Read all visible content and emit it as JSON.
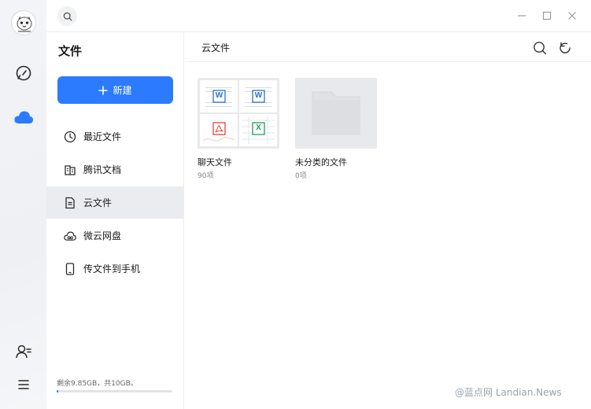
{
  "sidebar": {
    "title": "文件",
    "new_button_label": "新建",
    "items": [
      {
        "label": "最近文件",
        "icon": "clock-icon",
        "active": false
      },
      {
        "label": "腾讯文档",
        "icon": "tencent-docs-icon",
        "active": false
      },
      {
        "label": "云文件",
        "icon": "document-icon",
        "active": true
      },
      {
        "label": "微云网盘",
        "icon": "cloud-drive-icon",
        "active": false
      },
      {
        "label": "传文件到手机",
        "icon": "phone-icon",
        "active": false
      }
    ],
    "storage_text": "剩余9.85GB，共10GB。",
    "storage_used_fraction": 0.015
  },
  "main": {
    "title": "云文件",
    "folders": [
      {
        "name": "聊天文件",
        "count": "90项"
      },
      {
        "name": "未分类的文件",
        "count": "0项"
      }
    ]
  },
  "thumb_badges": [
    "W",
    "W",
    "",
    "X"
  ],
  "watermark": "@蓝点网 Landian.News",
  "colors": {
    "accent": "#2c7bff",
    "word": "#2b6fd6",
    "pdf": "#e0453a",
    "excel": "#1f9d55"
  }
}
